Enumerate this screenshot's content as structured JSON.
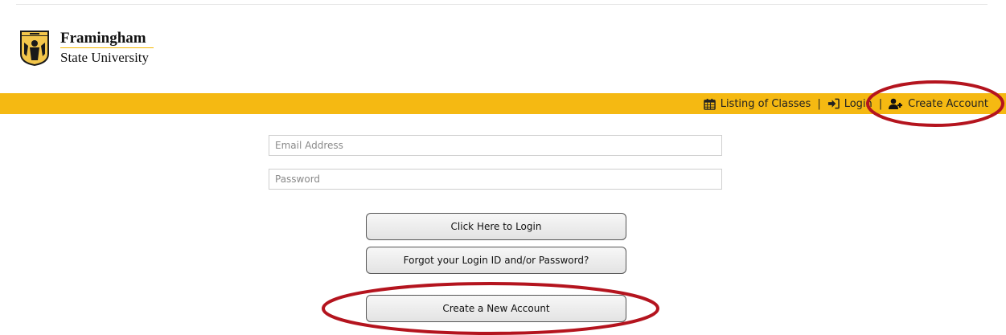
{
  "brand": {
    "name_line1": "Framingham",
    "name_line2": "State University",
    "accent_color": "#f5b912",
    "seal_icon": "university-seal-icon"
  },
  "nav": {
    "listing": {
      "label": "Listing of Classes",
      "icon": "calendar-icon"
    },
    "login": {
      "label": "Login",
      "icon": "sign-in-icon"
    },
    "create": {
      "label": "Create Account",
      "icon": "user-plus-icon"
    },
    "separator": "|"
  },
  "form": {
    "email_placeholder": "Email Address",
    "email_value": "",
    "password_placeholder": "Password",
    "password_value": "",
    "login_button": "Click Here to Login",
    "forgot_button": "Forgot your Login ID and/or Password?",
    "create_button": "Create a New Account"
  },
  "annotations": {
    "highlight_color": "#b4141e",
    "circled": [
      "nav-create-account",
      "create-account-button"
    ]
  }
}
